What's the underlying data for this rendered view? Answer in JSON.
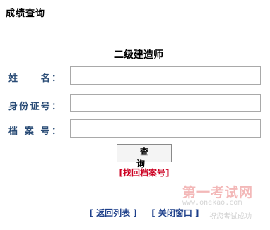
{
  "header": {
    "title": "成绩查询"
  },
  "form": {
    "title": "二级建造师",
    "fields": [
      {
        "label": "姓　　名：",
        "value": "",
        "placeholder": ""
      },
      {
        "label": "身份证号：",
        "value": "",
        "placeholder": ""
      },
      {
        "label": "档 案 号：",
        "value": "",
        "placeholder": ""
      }
    ],
    "query_button": "查　询",
    "retrieve_link": "[找回档案号]"
  },
  "footer": {
    "back_to_list": "[ 返回列表 ]",
    "close_window": "[ 关闭窗口 ]"
  },
  "watermark": {
    "logo_text": "第一考试网",
    "url_text": "www.onekao.com",
    "slogan": "祝您考试成功"
  },
  "colors": {
    "label_blue": "#2a4c76",
    "link_red": "#cc0022",
    "link_blue": "#1d3f8a",
    "watermark_red": "#f3b8b8"
  }
}
